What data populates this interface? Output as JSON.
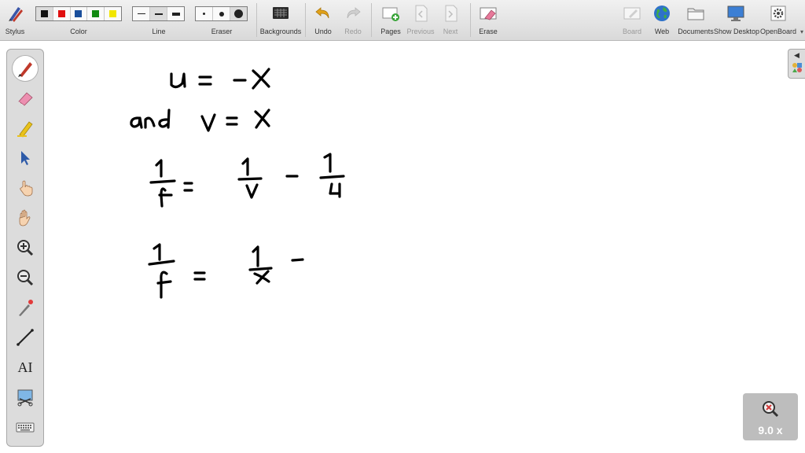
{
  "toolbar": {
    "stylus_label": "Stylus",
    "color_label": "Color",
    "colors": [
      "#111111",
      "#e01010",
      "#1a4f9c",
      "#128a12",
      "#f2e600"
    ],
    "line_label": "Line",
    "eraser_label": "Eraser",
    "backgrounds_label": "Backgrounds",
    "undo_label": "Undo",
    "redo_label": "Redo",
    "pages_label": "Pages",
    "previous_label": "Previous",
    "next_label": "Next",
    "erase_label": "Erase",
    "board_label": "Board",
    "web_label": "Web",
    "documents_label": "Documents",
    "show_desktop_label": "Show Desktop",
    "openboard_label": "OpenBoard"
  },
  "palette": {
    "tools": [
      "pen-icon",
      "eraser-icon",
      "marker-icon",
      "selector-icon",
      "interact-icon",
      "hand-icon",
      "zoom-in-icon",
      "zoom-out-icon",
      "laser-pointer-icon",
      "line-icon",
      "text-icon",
      "capture-icon",
      "keyboard-icon"
    ],
    "text_tool_label": "AI",
    "selected": "pen-icon"
  },
  "zoom": {
    "value": "9.0 x"
  },
  "board": {
    "handwriting": [
      "u = -x",
      "and v = x",
      "1/f = 1/v - 1/u",
      "1/f = 1/x -"
    ]
  }
}
